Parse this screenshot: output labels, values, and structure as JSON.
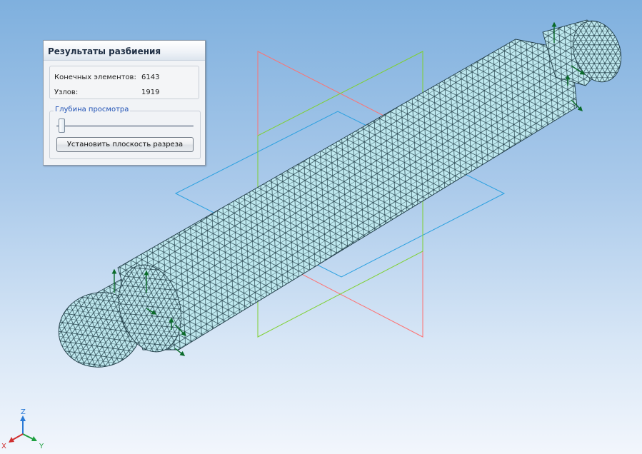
{
  "panel": {
    "title": "Результаты разбиения",
    "stats": {
      "elements_label": "Конечных элементов:",
      "elements_value": "6143",
      "nodes_label": "Узлов:",
      "nodes_value": "1919"
    },
    "view_depth": {
      "group_label": "Глубина просмотра",
      "slider_value": 0
    },
    "set_section_button_label": "Установить плоскость разреза"
  },
  "triad": {
    "x_label": "X",
    "y_label": "Y",
    "z_label": "Z"
  },
  "colors": {
    "viewport_top": "#7fb0de",
    "viewport_bottom": "#f2f6fc",
    "mesh_fill": "#bfe9ef",
    "mesh_lines": "#1f3b45",
    "plane_front": "#ff7070",
    "plane_right": "#2aa0e0",
    "plane_top": "#7ed030",
    "constraint_arrows": "#0a6a2a"
  }
}
